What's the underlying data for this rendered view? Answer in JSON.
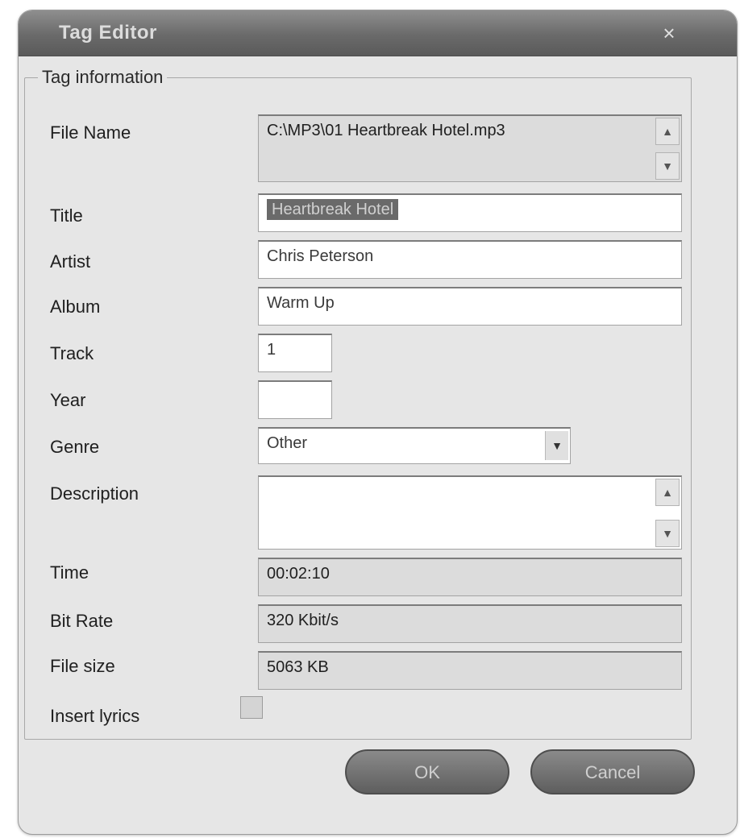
{
  "window": {
    "title": "Tag Editor",
    "close_glyph": "×"
  },
  "group": {
    "legend": "Tag information"
  },
  "labels": {
    "file_name": "File Name",
    "title": "Title",
    "artist": "Artist",
    "album": "Album",
    "track": "Track",
    "year": "Year",
    "genre": "Genre",
    "description": "Description",
    "time": "Time",
    "bit_rate": "Bit Rate",
    "file_size": "File size",
    "insert_lyrics": "Insert lyrics"
  },
  "fields": {
    "file_name": "C:\\MP3\\01 Heartbreak Hotel.mp3",
    "title": "Heartbreak Hotel",
    "artist": "Chris Peterson",
    "album": "Warm Up",
    "track": "1",
    "year": "",
    "genre": "Other",
    "description": "",
    "time": "00:02:10",
    "bit_rate": "320 Kbit/s",
    "file_size": "5063 KB",
    "insert_lyrics_checked": false
  },
  "buttons": {
    "ok": "OK",
    "cancel": "Cancel"
  },
  "icons": {
    "scroll_up": "▲",
    "scroll_down": "▼",
    "dropdown": "▼"
  }
}
